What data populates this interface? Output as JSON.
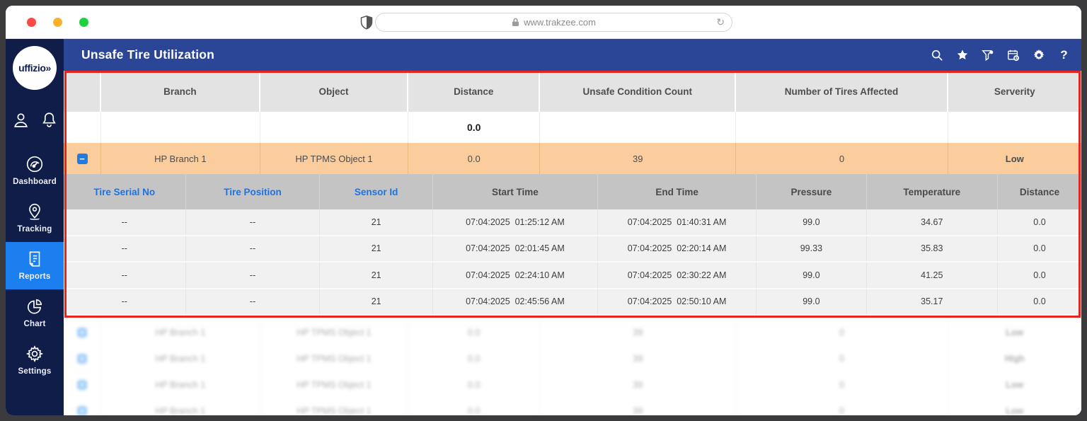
{
  "browser": {
    "url": "www.trakzee.com"
  },
  "sidebar": {
    "logo_text": "uffizio»",
    "nav": [
      {
        "label": "Dashboard",
        "icon": "speedometer-icon",
        "active": false
      },
      {
        "label": "Tracking",
        "icon": "map-pin-icon",
        "active": false
      },
      {
        "label": "Reports",
        "icon": "report-doc-icon",
        "active": true
      },
      {
        "label": "Chart",
        "icon": "pie-chart-icon",
        "active": false
      },
      {
        "label": "Settings",
        "icon": "gear-icon",
        "active": false
      }
    ]
  },
  "appbar": {
    "title": "Unsafe Tire Utilization",
    "icons": [
      "search-icon",
      "favorites-star-icon",
      "filter-funnel-icon",
      "schedule-calendar-icon",
      "settings-gear-icon",
      "help-icon"
    ],
    "help_glyph": "?"
  },
  "colors": {
    "appbar_blue": "#2b4697",
    "sidebar_navy": "#101d49",
    "active_nav_blue": "#1b7ff0",
    "highlight_orange": "#fbcd9d",
    "severity_low_green": "#3ca44a",
    "severity_high_red": "#ef5360",
    "link_blue": "#1a73e8",
    "annotation_red": "#e62520"
  },
  "report_table": {
    "columns": [
      "",
      "Branch",
      "Object",
      "Distance",
      "Unsafe Condition Count",
      "Number of Tires Affected",
      "Serverity"
    ],
    "summary_row": {
      "distance": "0.0"
    },
    "expanded_row": {
      "expander": "−",
      "branch": "HP Branch 1",
      "object": "HP TPMS Object 1",
      "distance": "0.0",
      "unsafe_condition_count": "39",
      "tires_affected": "0",
      "severity": "Low"
    }
  },
  "detail_table": {
    "columns": [
      "Tire Serial No",
      "Tire Position",
      "Sensor Id",
      "Start Time",
      "End Time",
      "Pressure",
      "Temperature",
      "Distance"
    ],
    "rows": [
      {
        "serial": "--",
        "position": "--",
        "sensor_id": "21",
        "start": "07:04:2025  01:25:12 AM",
        "end": "07:04:2025  01:40:31 AM",
        "pressure": "99.0",
        "temperature": "34.67",
        "distance": "0.0"
      },
      {
        "serial": "--",
        "position": "--",
        "sensor_id": "21",
        "start": "07:04:2025  02:01:45 AM",
        "end": "07:04:2025  02:20:14 AM",
        "pressure": "99.33",
        "temperature": "35.83",
        "distance": "0.0"
      },
      {
        "serial": "--",
        "position": "--",
        "sensor_id": "21",
        "start": "07:04:2025  02:24:10 AM",
        "end": "07:04:2025  02:30:22 AM",
        "pressure": "99.0",
        "temperature": "41.25",
        "distance": "0.0"
      },
      {
        "serial": "--",
        "position": "--",
        "sensor_id": "21",
        "start": "07:04:2025  02:45:56 AM",
        "end": "07:04:2025  02:50:10 AM",
        "pressure": "99.0",
        "temperature": "35.17",
        "distance": "0.0"
      }
    ]
  },
  "collapsed_rows": [
    {
      "expander": "+",
      "branch": "HP Branch 1",
      "object": "HP TPMS Object 1",
      "distance": "0.0",
      "unsafe_condition_count": "39",
      "tires_affected": "0",
      "severity": "Low"
    },
    {
      "expander": "+",
      "branch": "HP Branch 1",
      "object": "HP TPMS Object 1",
      "distance": "0.0",
      "unsafe_condition_count": "39",
      "tires_affected": "0",
      "severity": "High"
    },
    {
      "expander": "+",
      "branch": "HP Branch 1",
      "object": "HP TPMS Object 1",
      "distance": "0.0",
      "unsafe_condition_count": "39",
      "tires_affected": "0",
      "severity": "Low"
    },
    {
      "expander": "+",
      "branch": "HP Branch 1",
      "object": "HP TPMS Object 1",
      "distance": "0.0",
      "unsafe_condition_count": "39",
      "tires_affected": "0",
      "severity": "Low"
    }
  ]
}
